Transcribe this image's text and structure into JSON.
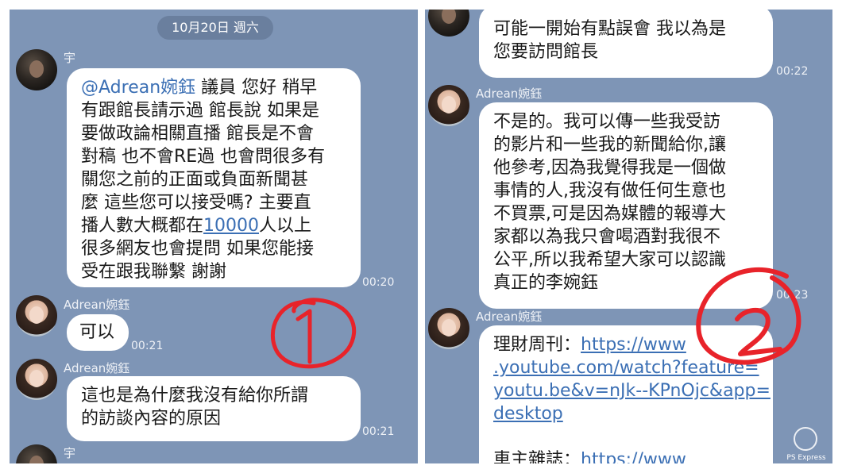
{
  "left": {
    "date": "10月20日 週六",
    "m1": {
      "sender": "宇",
      "mention": "@Adrean婉鈺",
      "l1_rest": " 議員 您好 稍早",
      "l2": "有跟館長請示過 館長說 如果是",
      "l3": "要做政論相關直播 館長是不會",
      "l4": "對稿 也不會RE過 也會問很多有",
      "l5": "關您之前的正面或負面新聞甚",
      "l6": "麼 這些您可以接受嗎? 主要直",
      "l7_pre": "播人數大概都在",
      "l7_num": "10000",
      "l7_post": "人以上",
      "l8": "很多網友也會提問 如果您能接",
      "l9": "受在跟我聯繫 謝謝",
      "time": "00:20"
    },
    "m2": {
      "sender": "Adrean婉鈺",
      "text": "可以",
      "time": "00:21"
    },
    "m3": {
      "sender": "Adrean婉鈺",
      "l1": "這也是為什麼我沒有給你所謂",
      "l2": "的訪談內容的原因",
      "time": "00:21"
    },
    "m4": {
      "sender": "宇"
    }
  },
  "right": {
    "m1": {
      "l1": "可能一開始有點誤會 我以為是",
      "l2": "您要訪問館長",
      "time": "00:22"
    },
    "m2": {
      "sender": "Adrean婉鈺",
      "l1": "不是的。我可以傳一些我受訪",
      "l2": "的影片和一些我的新聞給你,讓",
      "l3": "他參考,因為我覺得我是一個做",
      "l4": "事情的人,我沒有做任何生意也",
      "l5": "不買票,可是因為媒體的報導大",
      "l6": "家都以為我只會喝酒對我很不",
      "l7": "公平,所以我希望大家可以認識",
      "l8": "真正的李婉鈺",
      "time": "00:23"
    },
    "m3": {
      "sender": "Adrean婉鈺",
      "label1": "理財周刊：",
      "url1a": "https://www",
      "url1b": ".youtube.com/watch?feature=",
      "url1c": "youtu.be&v=nJk--KPnOjc&app=",
      "url1d": "desktop",
      "label2": "車主雜誌：",
      "url2a": "https://www"
    }
  },
  "annotations": {
    "one": "1",
    "two": "2",
    "color": "#e8232a"
  },
  "watermark": "PS Express",
  "colors": {
    "chat_bg": "#7e95b6",
    "bubble": "#ffffff",
    "link": "#3b6fb4"
  }
}
